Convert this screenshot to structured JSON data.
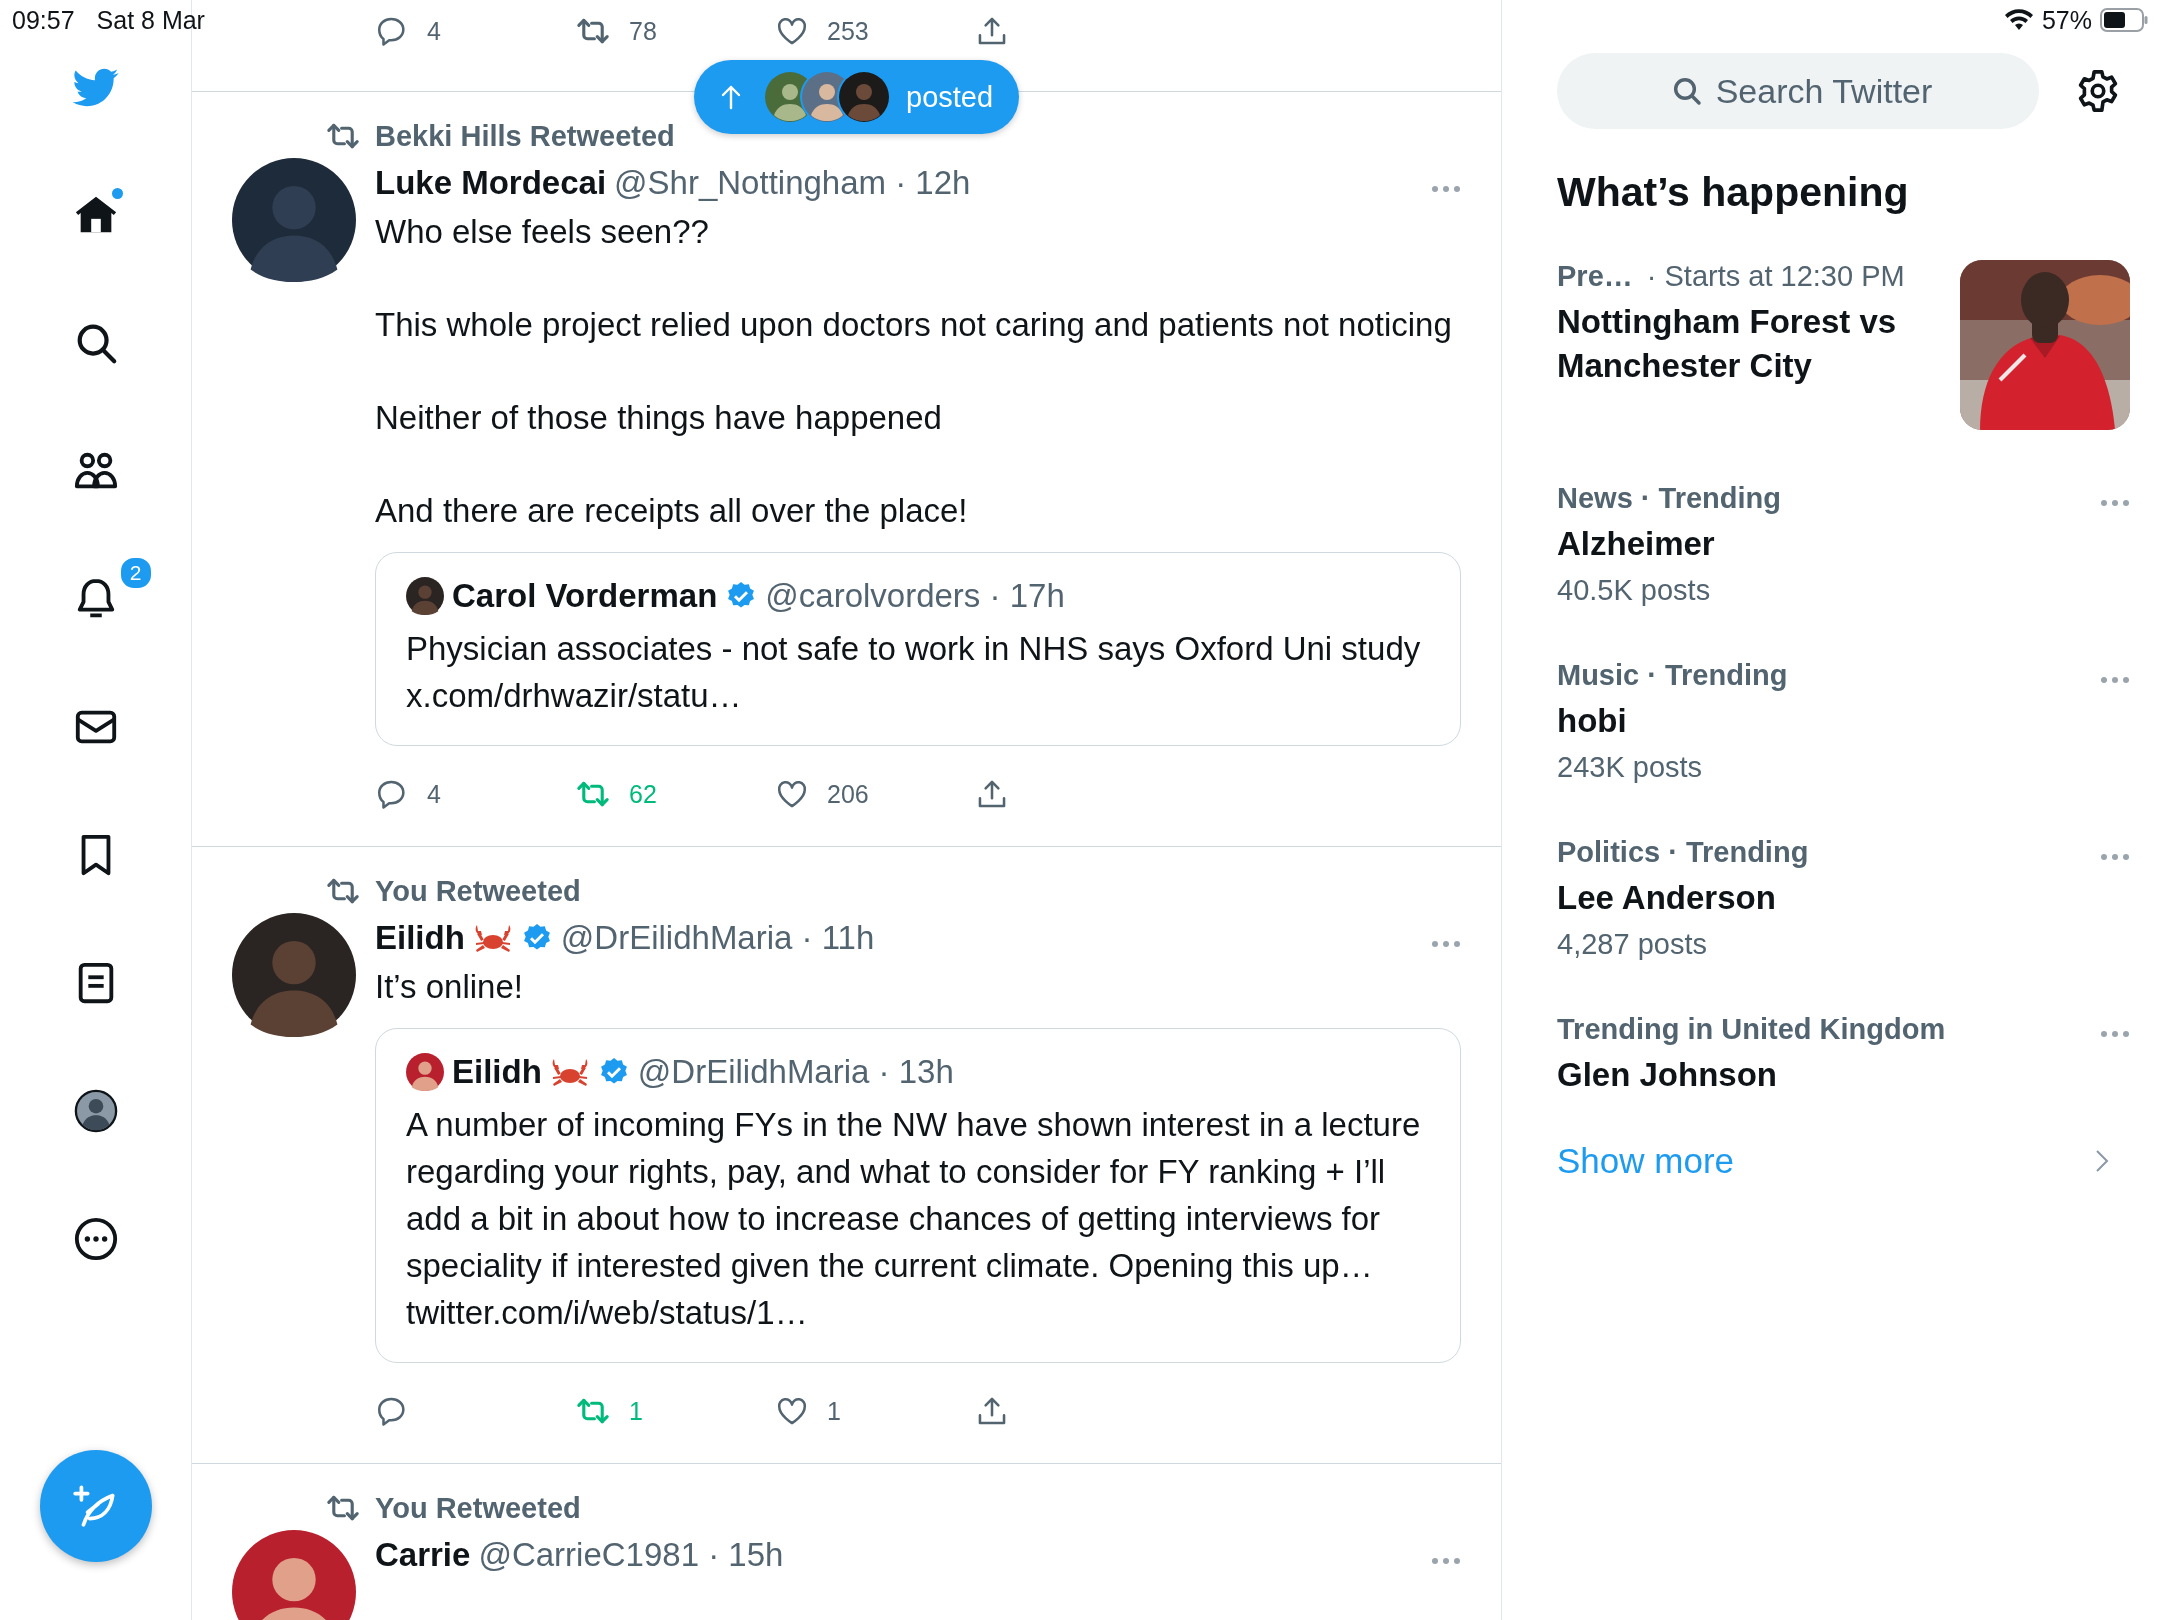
{
  "status_bar": {
    "time": "09:57",
    "date": "Sat 8 Mar",
    "battery": "57%"
  },
  "nav": [
    {
      "kind": "logo"
    },
    {
      "kind": "home",
      "dot": true
    },
    {
      "kind": "search"
    },
    {
      "kind": "communities"
    },
    {
      "kind": "notifications",
      "badge": "2"
    },
    {
      "kind": "messages"
    },
    {
      "kind": "bookmarks"
    },
    {
      "kind": "lists"
    },
    {
      "kind": "profile"
    },
    {
      "kind": "more"
    }
  ],
  "top_partial_actions": {
    "reply": "4",
    "retweet": "78",
    "like": "253"
  },
  "new_posts_pill": {
    "label": "posted"
  },
  "tweets": [
    {
      "context": "Bekki Hills Retweeted",
      "name": "Luke Mordecai",
      "handle_time": "@Shr_Nottingham · 12h",
      "paragraphs": [
        "Who else feels seen??",
        "This whole project relied upon doctors not caring and patients not noticing",
        "Neither of those things have happened",
        "And there are receipts all over the place!"
      ],
      "quote": {
        "name": "Carol Vorderman",
        "verified": true,
        "handle_time": "@carolvorders · 17h",
        "text": "Physician associates - not safe to work in NHS says Oxford Uni study x.com/drhwazir/statu…"
      },
      "actions": {
        "reply": "4",
        "retweet": "62",
        "retweeted": true,
        "like": "206"
      }
    },
    {
      "context": "You Retweeted",
      "name": "Eilidh",
      "crab_emoji": true,
      "verified": true,
      "handle_time": "@DrEilidhMaria · 11h",
      "paragraphs": [
        "It’s online!"
      ],
      "quote": {
        "name": "Eilidh",
        "crab_emoji": true,
        "verified": true,
        "handle_time": "@DrEilidhMaria · 13h",
        "text": "A number of incoming FYs in the NW have shown interest in a lecture regarding your rights, pay, and what to consider for FY ranking + I’ll add a bit in about how to increase chances of getting interviews for speciality if interested given the current climate. Opening this up… twitter.com/i/web/status/1…"
      },
      "actions": {
        "retweet": "1",
        "retweeted": true,
        "like": "1"
      }
    },
    {
      "context": "You Retweeted",
      "name": "Carrie",
      "handle_time": "@CarrieC1981 · 15h"
    }
  ],
  "search": {
    "placeholder": "Search Twitter"
  },
  "trends_title": "What’s happening",
  "trends": [
    {
      "kind": "event",
      "category": "Pre…",
      "meta": "· Starts at 12:30 PM",
      "title": "Nottingham Forest vs Manchester City"
    },
    {
      "kind": "trend",
      "category": "News · Trending",
      "title": "Alzheimer",
      "posts": "40.5K posts"
    },
    {
      "kind": "trend",
      "category": "Music · Trending",
      "title": "hobi",
      "posts": "243K posts"
    },
    {
      "kind": "trend",
      "category": "Politics · Trending",
      "title": "Lee Anderson",
      "posts": "4,287 posts"
    },
    {
      "kind": "trend",
      "category": "Trending in United Kingdom",
      "title": "Glen Johnson"
    }
  ],
  "show_more": "Show more"
}
